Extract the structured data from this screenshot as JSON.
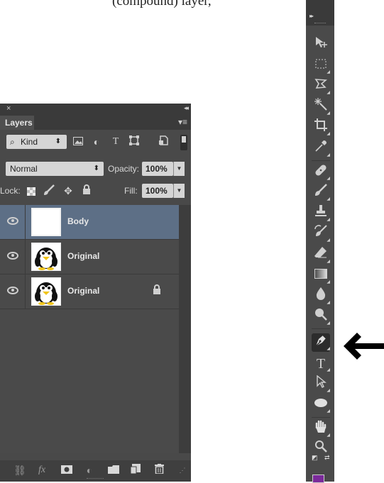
{
  "caption_fragment": "(compound) layer,",
  "layers_panel": {
    "close": "×",
    "collapse": "◂◂",
    "tab_label": "Layers",
    "menu_icon": "panel-menu-icon",
    "filter": {
      "kind_label": "Kind",
      "icons": [
        "pixel-filter-icon",
        "adjustment-filter-icon",
        "type-filter-icon",
        "shape-filter-icon",
        "smart-object-filter-icon"
      ]
    },
    "blend_mode": "Normal",
    "opacity_label": "Opacity:",
    "opacity_value": "100%",
    "lock_label": "Lock:",
    "fill_label": "Fill:",
    "fill_value": "100%",
    "layers": [
      {
        "name": "Body",
        "selected": true,
        "thumbnail": "transparent",
        "locked": false
      },
      {
        "name": "Original",
        "selected": false,
        "thumbnail": "penguin",
        "locked": false
      },
      {
        "name": "Original",
        "selected": false,
        "thumbnail": "penguin",
        "locked": true
      }
    ],
    "bottom_icons": [
      "link-icon",
      "fx-icon",
      "mask-icon",
      "adjustment-icon",
      "folder-icon",
      "new-layer-icon",
      "trash-icon"
    ],
    "fx_label": "fx"
  },
  "tools_panel": {
    "tools": [
      "move-tool",
      "marquee-tool",
      "lasso-tool",
      "magic-wand-tool",
      "crop-tool",
      "eyedropper-tool",
      "healing-brush-tool",
      "brush-tool",
      "clone-stamp-tool",
      "history-brush-tool",
      "eraser-tool",
      "gradient-tool",
      "blur-tool",
      "dodge-tool",
      "pen-tool",
      "type-tool",
      "path-selection-tool",
      "ellipse-tool",
      "hand-tool",
      "zoom-tool"
    ],
    "active_tool": "pen-tool",
    "type_tool_glyph": "T",
    "foreground_color": "#7b2a9b"
  },
  "colors": {
    "panel_bg": "#494949",
    "selected_row": "#5d6f86",
    "toolbar_bg": "#4a4a4a"
  }
}
